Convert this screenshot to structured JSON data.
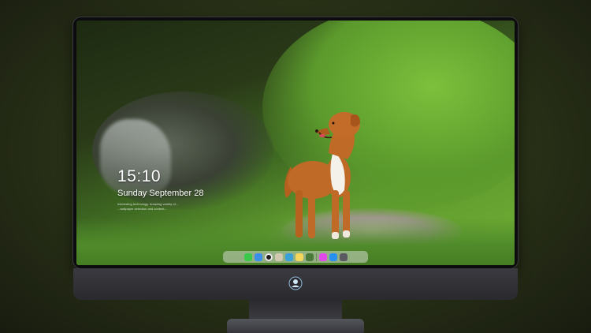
{
  "lock_screen": {
    "time": "15:10",
    "date": "Sunday September 28",
    "caption_line1": "Interesting technology. Amazing variety of...",
    "caption_line2": "...wallpaper selection and content..."
  },
  "dock": {
    "icons": [
      {
        "name": "messages-icon",
        "color": "#3cc84a"
      },
      {
        "name": "finder-icon",
        "color": "#3a8ee8"
      },
      {
        "name": "clock-icon",
        "color": "#1e1e1e"
      },
      {
        "name": "preview-icon",
        "color": "#d0c8b0"
      },
      {
        "name": "video-icon",
        "color": "#3aa0d8"
      },
      {
        "name": "notes-icon",
        "color": "#f4d65a"
      },
      {
        "name": "photos-icon",
        "color": "#4a7a3a"
      },
      {
        "name": "itunes-icon",
        "color": "#e04ae8"
      },
      {
        "name": "app-store-icon",
        "color": "#2a90f0"
      },
      {
        "name": "camera-icon",
        "color": "#5a5a60"
      }
    ]
  },
  "colors": {
    "monitor_frame": "#0c0c0e",
    "monitor_chin": "#2a2a2e",
    "dog_coat": "#c06a28",
    "dog_chest": "#f4f0ea"
  }
}
